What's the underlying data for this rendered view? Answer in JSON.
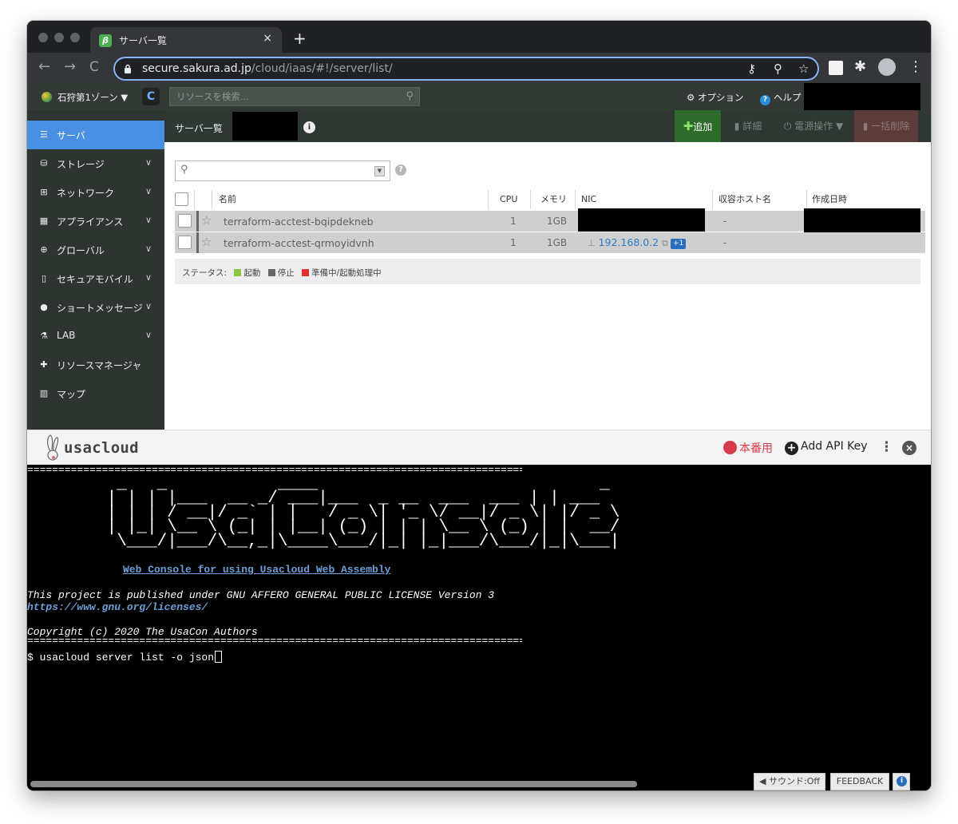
{
  "browser": {
    "tab_title": "サーバ一覧",
    "tab_favicon": "sakura-cloud-logo",
    "tab_close": "×",
    "new_tab": "+",
    "url_domain": "secure.sakura.ad.jp",
    "url_path": "/cloud/iaas/#!/server/list/"
  },
  "header": {
    "zone": "石狩第1ゾーン ▼",
    "reload_glyph": "C",
    "search_placeholder": "リソースを検索...",
    "options": "オプション",
    "help": "ヘルプ"
  },
  "sidebar": {
    "items": [
      {
        "label": "サーバ",
        "icon": "server-icon",
        "glyph": "☰",
        "active": true
      },
      {
        "label": "ストレージ",
        "icon": "storage-icon",
        "glyph": "⛁",
        "chevron": "∨"
      },
      {
        "label": "ネットワーク",
        "icon": "network-icon",
        "glyph": "⊞",
        "chevron": "∨"
      },
      {
        "label": "アプライアンス",
        "icon": "appliance-icon",
        "glyph": "▦",
        "chevron": "∨"
      },
      {
        "label": "グローバル",
        "icon": "globe-icon",
        "glyph": "⊕",
        "chevron": "∨"
      },
      {
        "label": "セキュアモバイル",
        "icon": "mobile-icon",
        "glyph": "▯",
        "chevron": "∨"
      },
      {
        "label": "ショートメッセージ",
        "icon": "chat-icon",
        "glyph": "●",
        "chevron": "∨"
      },
      {
        "label": "LAB",
        "icon": "flask-icon",
        "glyph": "⚗",
        "chevron": "∨"
      },
      {
        "label": "リソースマネージャ",
        "icon": "puzzle-icon",
        "glyph": "✚"
      },
      {
        "label": "マップ",
        "icon": "map-icon",
        "glyph": "▥"
      }
    ]
  },
  "content": {
    "breadcrumb": "サーバ一覧",
    "actions": {
      "add": "追加",
      "detail": "詳細",
      "power": "電源操作 ▼",
      "bulk_delete": "一括削除"
    },
    "columns": {
      "name": "名前",
      "cpu": "CPU",
      "memory": "メモリ",
      "nic": "NIC",
      "host": "収容ホスト名",
      "created": "作成日時"
    },
    "rows": [
      {
        "name": "terraform-acctest-bqipdekneb",
        "cpu": "1",
        "memory": "1GB",
        "nic": "",
        "host": "-"
      },
      {
        "name": "terraform-acctest-qrmoyidvnh",
        "cpu": "1",
        "memory": "1GB",
        "nic": "192.168.0.2",
        "nic_extra": "+1",
        "host": "-"
      }
    ],
    "status_legend": {
      "label": "ステータス:",
      "items": [
        {
          "label": "起動",
          "color": "#8ec63f"
        },
        {
          "label": "停止",
          "color": "#666666"
        },
        {
          "label": "準備中/起動処理中",
          "color": "#e53030"
        }
      ]
    }
  },
  "usacloud": {
    "brand": "usacloud",
    "env_label": "本番用",
    "add_api_key": "Add API Key",
    "kebab": "⋮",
    "close": "×"
  },
  "terminal": {
    "rule": "================================================================================",
    "banner": "       _   _           ____                            _\n      | | | |___  __ _/ ___|___  _ __  ___  ___ | | ___\n      | | | / __|/ _` | |   / _ \\| '_ \\/ __|/ _ \\| |/ _ \\\n      | |_| \\__ \\ (_| | |__| (_) | | | \\__ \\ (_) | |  __/\n       \\___/|___/\\__,_|\\____\\___/|_| |_|___/\\___/|_|\\___|",
    "web_console": "Web Console for using Usacloud Web Assembly",
    "license": "This project is published under GNU AFFERO GENERAL PUBLIC LICENSE Version 3",
    "license_url": "https://www.gnu.org/licenses/",
    "copyright": "Copyright (c) 2020 The UsaCon Authors",
    "prompt": "$ usacloud server list -o json"
  },
  "footer": {
    "sound": "サウンド:Off",
    "feedback": "FEEDBACK",
    "info": "i"
  },
  "colors": {
    "active_nav": "#4a90e2",
    "add_button": "#2e6b2a",
    "link": "#2d7bc4",
    "prod_red": "#d63b4b"
  }
}
